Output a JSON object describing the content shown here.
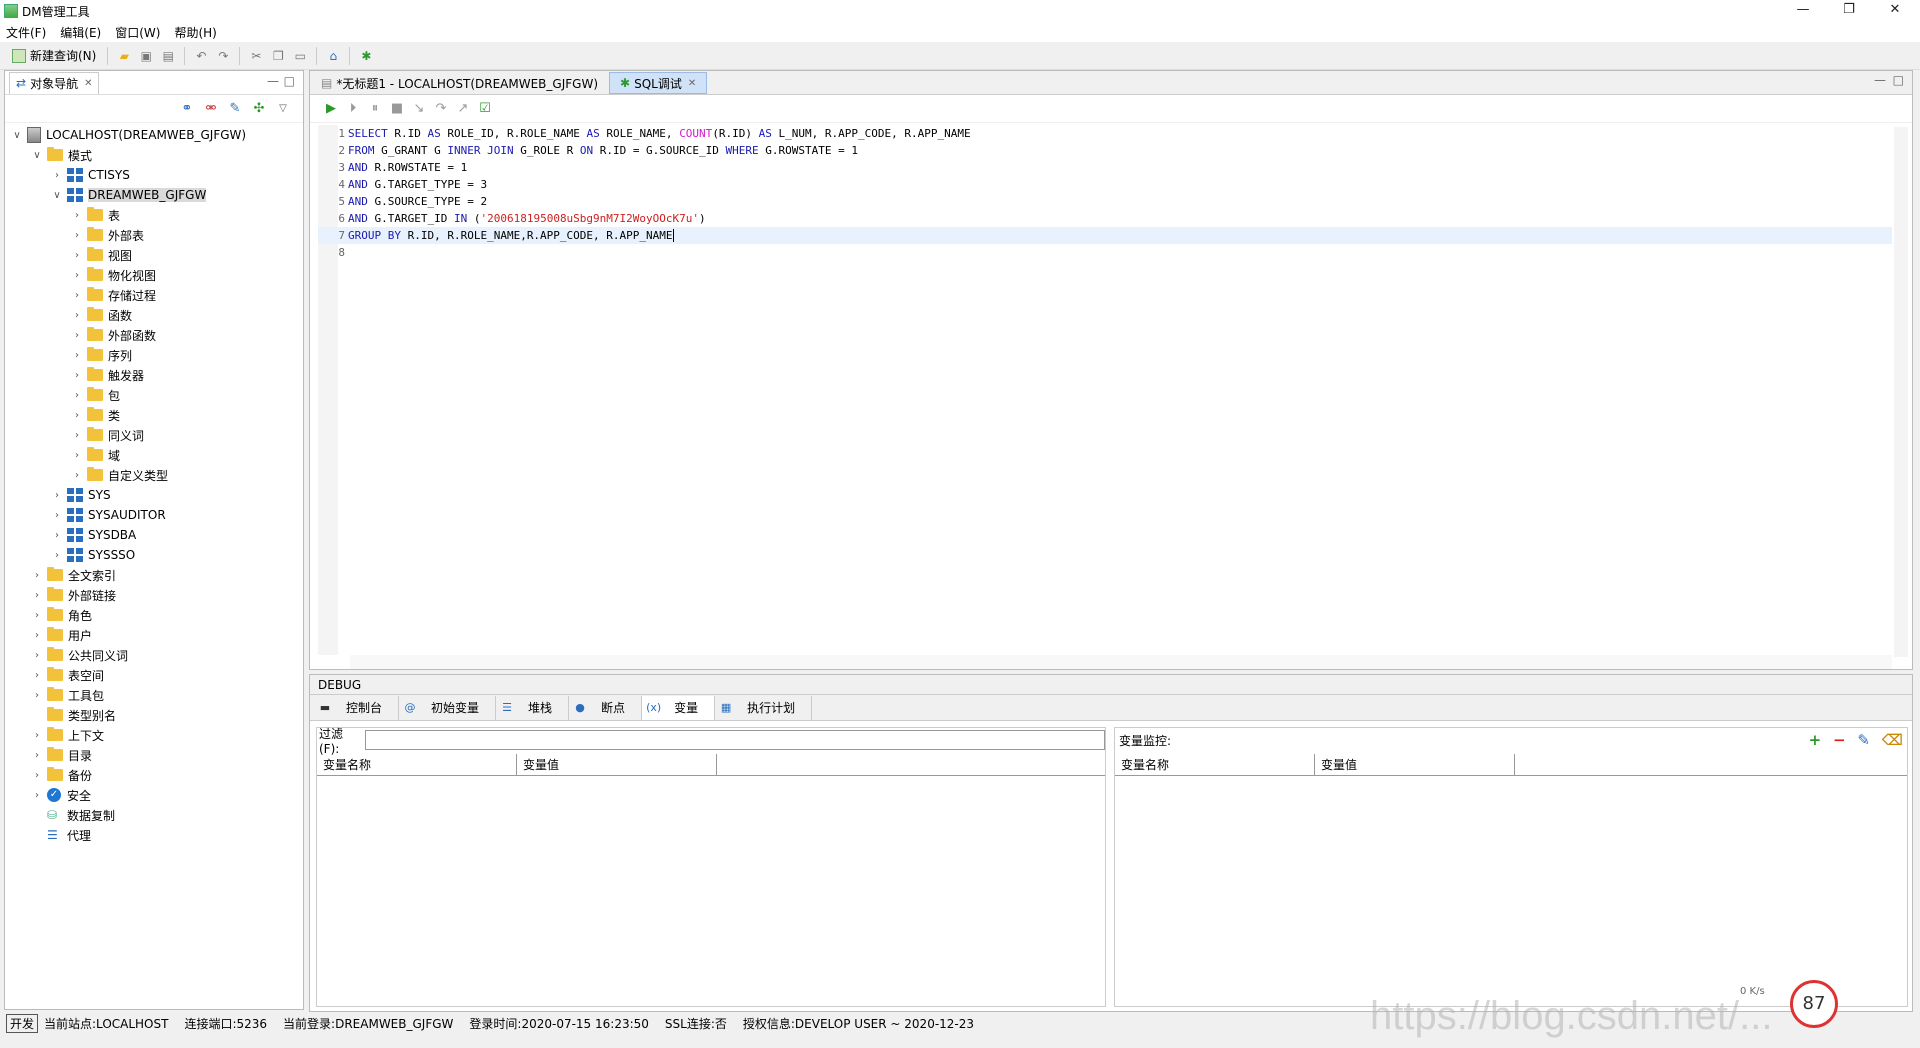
{
  "window": {
    "title": "DM管理工具"
  },
  "menu": [
    "文件(F)",
    "编辑(E)",
    "窗口(W)",
    "帮助(H)"
  ],
  "toolbar": {
    "new_query": "新建查询(N)"
  },
  "nav": {
    "tab": "对象导航",
    "root": "LOCALHOST(DREAMWEB_GJFGW)",
    "schema_group": "模式",
    "schemas": {
      "ctisys": "CTISYS",
      "current": "DREAMWEB_GJFGW",
      "children": [
        "表",
        "外部表",
        "视图",
        "物化视图",
        "存储过程",
        "函数",
        "外部函数",
        "序列",
        "触发器",
        "包",
        "类",
        "同义词",
        "域",
        "自定义类型"
      ],
      "others": [
        "SYS",
        "SYSAUDITOR",
        "SYSDBA",
        "SYSSSO"
      ]
    },
    "top_items": [
      "全文索引",
      "外部链接",
      "角色",
      "用户",
      "公共同义词",
      "表空间",
      "工具包"
    ],
    "type_alias": "类型别名",
    "more_items": [
      "上下文",
      "目录",
      "备份"
    ],
    "security": "安全",
    "replication": "数据复制",
    "agent": "代理"
  },
  "editor": {
    "tabs": [
      "*无标题1 - LOCALHOST(DREAMWEB_GJFGW)",
      "SQL调试"
    ],
    "lines": [
      "1",
      "2",
      "3",
      "4",
      "5",
      "6",
      "7",
      "8"
    ]
  },
  "debug": {
    "header": "DEBUG",
    "tabs": [
      "控制台",
      "初始变量",
      "堆栈",
      "断点",
      "变量",
      "执行计划"
    ],
    "filter_label": "过滤(F):",
    "columns": [
      "变量名称",
      "变量值"
    ],
    "monitor_label": "变量监控:"
  },
  "status": {
    "mode": "开发",
    "site": "当前站点:LOCALHOST",
    "port": "连接端口:5236",
    "login": "当前登录:DREAMWEB_GJFGW",
    "login_time": "登录时间:2020-07-15 16:23:50",
    "ssl": "SSL连接:否",
    "license": "授权信息:DEVELOP USER ~ 2020-12-23"
  },
  "overlay": {
    "watermark": "https://blog.csdn.net/...",
    "gauge": "87",
    "net": "0 K/s"
  }
}
